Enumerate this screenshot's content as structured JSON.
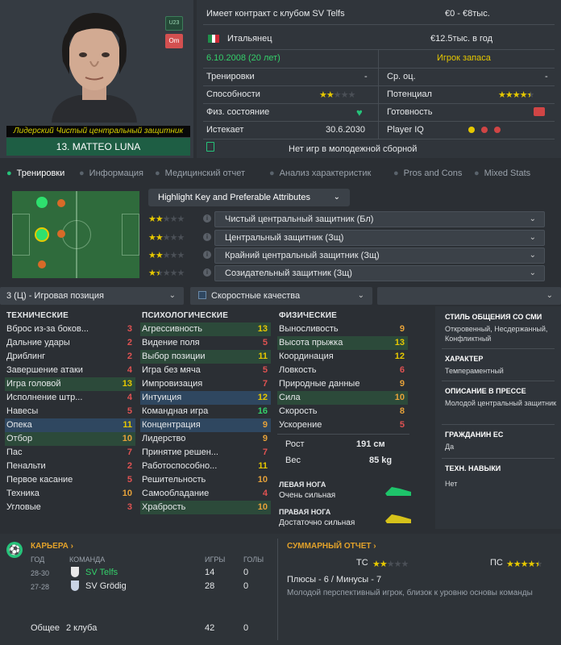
{
  "profile": {
    "badge_u23": "U23",
    "badge_pos": "Om",
    "role": "Лидерский Чистый центральный защитник",
    "name": "13. MATTEO LUNA"
  },
  "info": {
    "contract": "Имеет контракт с клубом SV Telfs",
    "value": "€0 - €8тыс.",
    "nationality": "Итальянец",
    "wage": "€12.5тыс. в год",
    "dob": "6.10.2008 (20 лет)",
    "squad_status": "Игрок запаса",
    "training_label": "Тренировки",
    "training_val": "-",
    "avg_label": "Ср. оц.",
    "avg_val": "-",
    "ability_label": "Способности",
    "ability_stars": 2,
    "potential_label": "Потенциал",
    "potential_stars": 4.5,
    "condition_label": "Физ. состояние",
    "readiness_label": "Готовность",
    "expires_label": "Истекает",
    "expires_val": "30.6.2030",
    "iq_label": "Player IQ",
    "iq_colors": [
      "#e6c800",
      "#d04545",
      "#d04545"
    ],
    "youth": "Нет игр в молодежной сборной"
  },
  "tabs": [
    "Тренировки",
    "Информация",
    "Медицинский отчет",
    "Анализ характеристик",
    "Pros and Cons",
    "Mixed Stats"
  ],
  "highlight_btn": "Highlight Key and Preferable Attributes",
  "roles": [
    {
      "stars": 2,
      "label": "Чистый центральный защитник (Бл)"
    },
    {
      "stars": 2,
      "label": "Центральный защитник (Зщ)"
    },
    {
      "stars": 2,
      "label": "Крайний центральный защитник (Зщ)"
    },
    {
      "stars": 1.5,
      "label": "Созидательный защитник (Зщ)"
    }
  ],
  "dropdowns": {
    "position": "3 (Ц) - Игровая позиция",
    "attr_set": "Скоростные качества"
  },
  "technical": {
    "title": "ТЕХНИЧЕСКИЕ",
    "items": [
      [
        "Вброс из-за боков...",
        "3",
        ""
      ],
      [
        "Дальние удары",
        "2",
        ""
      ],
      [
        "Дриблинг",
        "2",
        ""
      ],
      [
        "Завершение атаки",
        "4",
        ""
      ],
      [
        "Игра головой",
        "13",
        "hl"
      ],
      [
        "Исполнение штр...",
        "4",
        ""
      ],
      [
        "Навесы",
        "5",
        ""
      ],
      [
        "Опека",
        "11",
        "hb"
      ],
      [
        "Отбор",
        "10",
        "hl"
      ],
      [
        "Пас",
        "7",
        ""
      ],
      [
        "Пенальти",
        "2",
        ""
      ],
      [
        "Первое касание",
        "5",
        ""
      ],
      [
        "Техника",
        "10",
        ""
      ],
      [
        "Угловые",
        "3",
        ""
      ]
    ]
  },
  "mental": {
    "title": "ПСИХОЛОГИЧЕСКИЕ",
    "items": [
      [
        "Агрессивность",
        "13",
        "hl"
      ],
      [
        "Видение поля",
        "5",
        ""
      ],
      [
        "Выбор позиции",
        "11",
        "hl"
      ],
      [
        "Игра без мяча",
        "5",
        ""
      ],
      [
        "Импровизация",
        "7",
        ""
      ],
      [
        "Интуиция",
        "12",
        "hb"
      ],
      [
        "Командная игра",
        "16",
        ""
      ],
      [
        "Концентрация",
        "9",
        "hb"
      ],
      [
        "Лидерство",
        "9",
        ""
      ],
      [
        "Принятие решен...",
        "7",
        ""
      ],
      [
        "Работоспособно...",
        "11",
        ""
      ],
      [
        "Решительность",
        "10",
        ""
      ],
      [
        "Самообладание",
        "4",
        ""
      ],
      [
        "Храбрость",
        "10",
        "hl"
      ]
    ]
  },
  "physical": {
    "title": "ФИЗИЧЕСКИЕ",
    "items": [
      [
        "Выносливость",
        "9",
        ""
      ],
      [
        "Высота прыжка",
        "13",
        "hl"
      ],
      [
        "Координация",
        "12",
        ""
      ],
      [
        "Ловкость",
        "6",
        ""
      ],
      [
        "Природные данные",
        "9",
        ""
      ],
      [
        "Сила",
        "10",
        "hl"
      ],
      [
        "Скорость",
        "8",
        ""
      ],
      [
        "Ускорение",
        "5",
        ""
      ]
    ]
  },
  "body": {
    "height_label": "Рост",
    "height": "191 см",
    "weight_label": "Вес",
    "weight": "85 kg",
    "left_label": "ЛЕВАЯ НОГА",
    "left_val": "Очень сильная",
    "right_label": "ПРАВАЯ НОГА",
    "right_val": "Достаточно сильная"
  },
  "sidebar": [
    {
      "h": "СТИЛЬ ОБЩЕНИЯ СО СМИ",
      "v": "Откровенный, Несдержанный, Конфликтный"
    },
    {
      "h": "ХАРАКТЕР",
      "v": "Темпераментный"
    },
    {
      "h": "ОПИСАНИЕ В ПРЕССЕ",
      "v": "Молодой центральный защитник"
    },
    {
      "h": "ГРАЖДАНИН ЕС",
      "v": "Да"
    },
    {
      "h": "ТЕХН. НАВЫКИ",
      "v": "Нет"
    }
  ],
  "career": {
    "title": "КАРЬЕРА ›",
    "h_year": "ГОД",
    "h_team": "КОМАНДА",
    "h_apps": "ИГРЫ",
    "h_goals": "ГОЛЫ",
    "rows": [
      [
        "28-30",
        "SV Telfs",
        "14",
        "0"
      ],
      [
        "27-28",
        "SV Grödig",
        "28",
        "0"
      ]
    ],
    "total_label": "Общее",
    "total_clubs": "2 клуба",
    "total_apps": "42",
    "total_goals": "0"
  },
  "report": {
    "title": "СУММАРНЫЙ ОТЧЕТ ›",
    "ts": "ТС",
    "ps": "ПС",
    "ts_stars": 2,
    "ps_stars": 4.5,
    "pros": "Плюсы - 6 / Минусы - 7",
    "desc": "Молодой перспективный игрок, близок к уровню основы команды"
  },
  "colors": {
    "accent": "#26c37a",
    "star": "#e6c800",
    "highlight_green": "#2c4a3a",
    "highlight_blue": "#2f4760"
  }
}
